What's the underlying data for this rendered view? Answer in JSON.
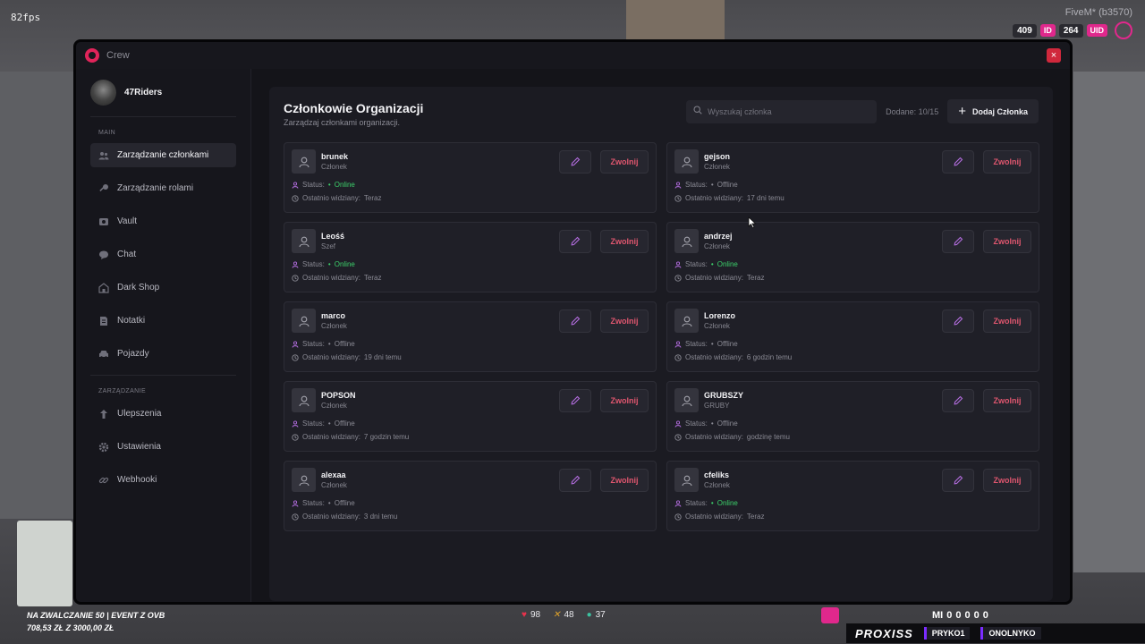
{
  "hud": {
    "fps": "82fps",
    "server": "FiveM* (b3570)",
    "id_value": "409",
    "id_label": "ID",
    "uid_value": "264",
    "uid_label": "UID",
    "bottom_line1": "NA ZWALCZANIE 50 | EVENT Z OVB",
    "bottom_line2": "708,53 ZŁ  Z  3000,00 ZŁ",
    "health": "98",
    "armor": "48",
    "thirst": "37",
    "money_prefix": "MI",
    "money_digits": "00000",
    "brand": "PROXISS",
    "chip1": "PRYKO1",
    "chip2": "ONOLNYKO"
  },
  "window": {
    "title": "Crew",
    "close": "×"
  },
  "sidebar": {
    "org_name": "47Riders",
    "section_main": "MAIN",
    "section_manage": "ZARZĄDZANIE",
    "main_items": [
      {
        "label": "Zarządzanie członkami",
        "icon": "users-icon"
      },
      {
        "label": "Zarządzanie rolami",
        "icon": "key-icon"
      },
      {
        "label": "Vault",
        "icon": "vault-icon"
      },
      {
        "label": "Chat",
        "icon": "chat-icon"
      },
      {
        "label": "Dark Shop",
        "icon": "shop-icon"
      },
      {
        "label": "Notatki",
        "icon": "notes-icon"
      },
      {
        "label": "Pojazdy",
        "icon": "car-icon"
      }
    ],
    "manage_items": [
      {
        "label": "Ulepszenia",
        "icon": "upgrade-icon"
      },
      {
        "label": "Ustawienia",
        "icon": "gear-icon"
      },
      {
        "label": "Webhooki",
        "icon": "link-icon"
      }
    ]
  },
  "main": {
    "title": "Członkowie Organizacji",
    "subtitle": "Zarządzaj członkami organizacji.",
    "search_placeholder": "Wyszukaj członka",
    "added": "Dodane: 10/15",
    "add_button": "Dodaj Członka",
    "fire_label": "Zwolnij",
    "status_label": "Status:",
    "last_seen_label": "Ostatnio widziany:",
    "members": [
      {
        "name": "brunek",
        "role": "Członek",
        "status": "Online",
        "last_seen": "Teraz"
      },
      {
        "name": "gejson",
        "role": "Członek",
        "status": "Offline",
        "last_seen": "17 dni temu"
      },
      {
        "name": "Leośś",
        "role": "Szef",
        "status": "Online",
        "last_seen": "Teraz"
      },
      {
        "name": "andrzej",
        "role": "Członek",
        "status": "Online",
        "last_seen": "Teraz"
      },
      {
        "name": "marco",
        "role": "Członek",
        "status": "Offline",
        "last_seen": "19 dni temu"
      },
      {
        "name": "Lorenzo",
        "role": "Członek",
        "status": "Offline",
        "last_seen": "6 godzin temu"
      },
      {
        "name": "POPSON",
        "role": "Członek",
        "status": "Offline",
        "last_seen": "7 godzin temu"
      },
      {
        "name": "GRUBSZY",
        "role": "GRUBY",
        "status": "Offline",
        "last_seen": "godzinę temu"
      },
      {
        "name": "alexaa",
        "role": "Członek",
        "status": "Offline",
        "last_seen": "3 dni temu"
      },
      {
        "name": "cfeliks",
        "role": "Członek",
        "status": "Online",
        "last_seen": "Teraz"
      }
    ]
  },
  "colors": {
    "online": "#3ccf6a",
    "fire": "#e0566f",
    "edit_icon": "#b46de0",
    "accent": "#e0288c"
  }
}
